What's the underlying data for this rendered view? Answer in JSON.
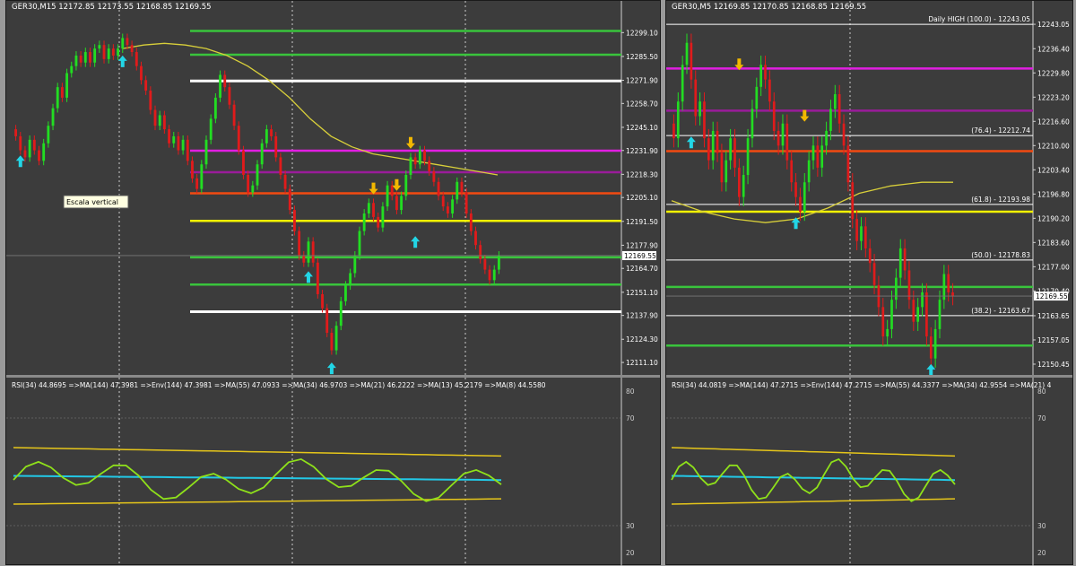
{
  "colors": {
    "background": "#3c3c3c",
    "bull": "#22dd22",
    "bear": "#e01b1b",
    "fib_green": "#39c43c",
    "fib_white": "#ffffff",
    "fib_magenta": "#e11ee1",
    "fib_purple": "#9a1c9a",
    "fib_orange": "#f24a12",
    "fib_yellow": "#f2f200",
    "ma_yellow": "#d8cf3a",
    "arrow_up": "#22d6e6",
    "arrow_down": "#f2b800",
    "rsi_line": "#8fe11a",
    "rsi_band": "#e6c61a",
    "rsi_cyan": "#22c8e6"
  },
  "left": {
    "header": "GER30,M15  12172.85 12173.55 12168.85 12169.55",
    "tooltip": "Escala vertical",
    "current_price": "12169.55",
    "price_ticks": [
      "12299.10",
      "12285.50",
      "12271.90",
      "12258.70",
      "12245.10",
      "12231.90",
      "12218.30",
      "12205.10",
      "12191.50",
      "12177.90",
      "12164.70",
      "12151.10",
      "12137.90",
      "12124.30",
      "12111.10"
    ],
    "rsi_header": "RSI(34) 44.8695  =>MA(144) 47.3981  =>Env(144) 47.3981  =>MA(55) 47.0933  =>MA(34) 46.9703  =>MA(21) 46.2222  =>MA(13) 45.2179  =>MA(8) 44.5580",
    "rsi_ticks": [
      "80",
      "70",
      "30",
      "20"
    ]
  },
  "right": {
    "header": "GER30,M5  12169.85 12170.85 12168.85 12169.55",
    "current_price": "12169.55",
    "price_ticks": [
      "12243.05",
      "12236.40",
      "12229.80",
      "12223.20",
      "12216.60",
      "12210.00",
      "12203.40",
      "12196.80",
      "12190.20",
      "12183.60",
      "12177.00",
      "12170.40",
      "12163.65",
      "12157.05",
      "12150.45"
    ],
    "level_labels": [
      "Daily HIGH (100.0)  -  12243.05",
      "(76.4)  -  12212.74",
      "(61.8)  -  12193.98",
      "(50.0)  -  12178.83",
      "(38.2)  -  12163.67"
    ],
    "rsi_header": "RSI(34) 44.0819  =>MA(144) 47.2715  =>Env(144) 47.2715  =>MA(55) 44.3377  =>MA(34) 42.9554  =>MA(21) 4",
    "rsi_ticks": [
      "80",
      "70",
      "30",
      "20"
    ]
  },
  "chart_data": [
    {
      "type": "candlestick",
      "title": "GER30,M15  12172.85 12173.55 12168.85 12169.55",
      "ylim": [
        12105,
        12310
      ],
      "y_ticks": [
        12299.1,
        12285.5,
        12271.9,
        12258.7,
        12245.1,
        12231.9,
        12218.3,
        12205.1,
        12191.5,
        12177.9,
        12164.7,
        12151.1,
        12137.9,
        12124.3,
        12111.1
      ],
      "levels": [
        {
          "price": 12300.0,
          "color": "#39c43c"
        },
        {
          "price": 12286.5,
          "color": "#39c43c"
        },
        {
          "price": 12271.5,
          "color": "#ffffff"
        },
        {
          "price": 12231.8,
          "color": "#e11ee1"
        },
        {
          "price": 12219.5,
          "color": "#9a1c9a"
        },
        {
          "price": 12207.5,
          "color": "#f24a12"
        },
        {
          "price": 12191.8,
          "color": "#f2f200"
        },
        {
          "price": 12171.0,
          "color": "#39c43c"
        },
        {
          "price": 12155.5,
          "color": "#39c43c"
        },
        {
          "price": 12140.0,
          "color": "#ffffff"
        }
      ],
      "closes": [
        12240,
        12232,
        12228,
        12238,
        12232,
        12226,
        12236,
        12246,
        12256,
        12268,
        12262,
        12276,
        12280,
        12286,
        12282,
        12288,
        12282,
        12290,
        12292,
        12284,
        12290,
        12286,
        12290,
        12296,
        12292,
        12288,
        12280,
        12272,
        12266,
        12255,
        12246,
        12252,
        12244,
        12236,
        12240,
        12232,
        12238,
        12226,
        12216,
        12210,
        12224,
        12238,
        12250,
        12262,
        12275,
        12268,
        12258,
        12246,
        12232,
        12218,
        12208,
        12212,
        12224,
        12236,
        12244,
        12240,
        12228,
        12218,
        12210,
        12198,
        12186,
        12172,
        12168,
        12180,
        12168,
        12150,
        12142,
        12128,
        12118,
        12132,
        12146,
        12155,
        12162,
        12172,
        12186,
        12196,
        12202,
        12194,
        12188,
        12200,
        12212,
        12206,
        12198,
        12206,
        12218,
        12228,
        12224,
        12232,
        12226,
        12220,
        12214,
        12206,
        12200,
        12196,
        12204,
        12214,
        12208,
        12196,
        12186,
        12178,
        12170,
        12164,
        12158,
        12164,
        12172
      ],
      "sma_144": [
        12290,
        12292,
        12293,
        12292,
        12290,
        12286,
        12280,
        12272,
        12262,
        12250,
        12240,
        12234,
        12230,
        12228,
        12226,
        12224,
        12222,
        12220,
        12218
      ],
      "up_arrows": [
        {
          "index": 1,
          "price": 12226
        },
        {
          "index": 23,
          "price": 12283
        },
        {
          "index": 63,
          "price": 12160
        },
        {
          "index": 68,
          "price": 12108
        },
        {
          "index": 86,
          "price": 12180
        }
      ],
      "down_arrows": [
        {
          "index": 77,
          "price": 12210
        },
        {
          "index": 82,
          "price": 12212
        },
        {
          "index": 85,
          "price": 12236
        }
      ]
    },
    {
      "type": "candlestick",
      "title": "GER30,M5  12169.85 12170.85 12168.85 12169.55",
      "ylim": [
        12148,
        12246
      ],
      "y_ticks": [
        12243.05,
        12236.4,
        12229.8,
        12223.2,
        12216.6,
        12210.0,
        12203.4,
        12196.8,
        12190.2,
        12183.6,
        12177.0,
        12170.4,
        12163.65,
        12157.05,
        12150.45
      ],
      "levels": [
        {
          "price": 12243.05,
          "color": "#ffffff",
          "label": "Daily HIGH (100.0)  -  12243.05"
        },
        {
          "price": 12231.0,
          "color": "#e11ee1"
        },
        {
          "price": 12219.5,
          "color": "#9a1c9a"
        },
        {
          "price": 12212.74,
          "color": "#ffffff",
          "label": "(76.4)  -  12212.74"
        },
        {
          "price": 12208.5,
          "color": "#f24a12"
        },
        {
          "price": 12193.98,
          "color": "#ffffff",
          "label": "(61.8)  -  12193.98"
        },
        {
          "price": 12192.0,
          "color": "#f2f200"
        },
        {
          "price": 12178.83,
          "color": "#ffffff",
          "label": "(50.0)  -  12178.83"
        },
        {
          "price": 12171.5,
          "color": "#39c43c"
        },
        {
          "price": 12163.67,
          "color": "#ffffff",
          "label": "(38.2)  -  12163.67"
        },
        {
          "price": 12155.5,
          "color": "#39c43c"
        }
      ],
      "closes": [
        12212,
        12222,
        12232,
        12238,
        12228,
        12218,
        12222,
        12212,
        12206,
        12214,
        12208,
        12200,
        12206,
        12212,
        12204,
        12196,
        12202,
        12212,
        12220,
        12226,
        12232,
        12228,
        12222,
        12214,
        12210,
        12216,
        12206,
        12200,
        12196,
        12192,
        12200,
        12206,
        12210,
        12204,
        12210,
        12214,
        12220,
        12224,
        12216,
        12210,
        12200,
        12190,
        12184,
        12188,
        12182,
        12178,
        12172,
        12166,
        12158,
        12160,
        12168,
        12174,
        12182,
        12176,
        12168,
        12162,
        12166,
        12170,
        12158,
        12152,
        12160,
        12168,
        12175,
        12170,
        12169
      ],
      "sma_144": [
        12195,
        12192,
        12190,
        12189,
        12190,
        12193,
        12197,
        12199,
        12200,
        12200
      ],
      "up_arrows": [
        {
          "index": 4,
          "price": 12211
        },
        {
          "index": 28,
          "price": 12189
        },
        {
          "index": 59,
          "price": 12149
        }
      ],
      "down_arrows": [
        {
          "index": 15,
          "price": 12232
        },
        {
          "index": 30,
          "price": 12218
        }
      ]
    }
  ]
}
